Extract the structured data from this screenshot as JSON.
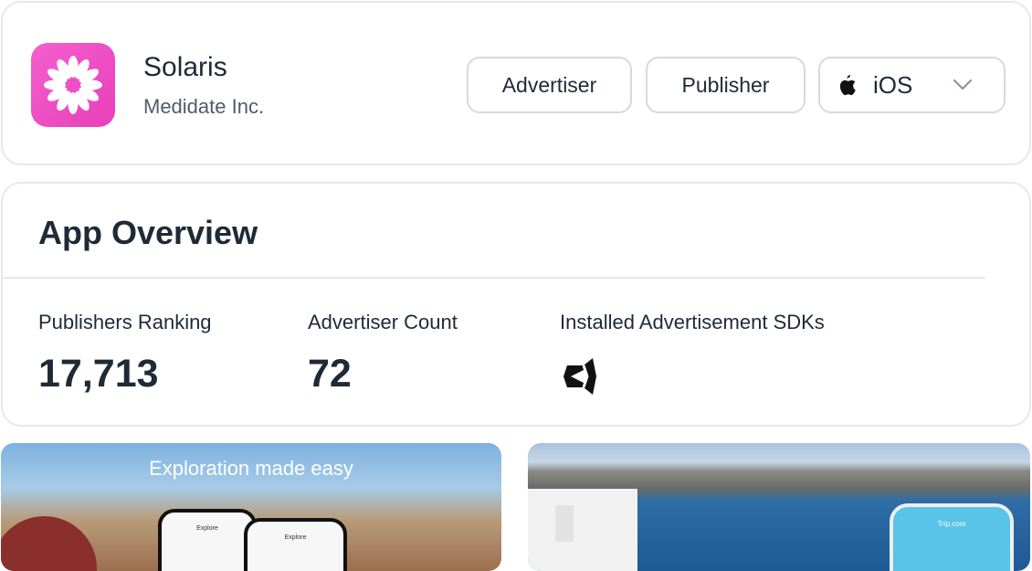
{
  "app": {
    "name": "Solaris",
    "company": "Medidate Inc.",
    "icon": "flower-icon",
    "icon_color": "#ee4fc4"
  },
  "toolbar": {
    "advertiser_label": "Advertiser",
    "publisher_label": "Publisher",
    "platform_label": "iOS",
    "platform_icon": "apple-icon"
  },
  "overview": {
    "title": "App Overview",
    "stats": [
      {
        "label": "Publishers Ranking",
        "value": "17,713"
      },
      {
        "label": "Advertiser Count",
        "value": "72"
      },
      {
        "label": "Installed Advertisement SDKs",
        "icon": "unity-icon"
      }
    ]
  },
  "screenshots": [
    {
      "caption": "Exploration made easy",
      "phone_titles": [
        "Explore",
        "Explore"
      ]
    },
    {
      "phone_title": "Trip.com"
    }
  ]
}
